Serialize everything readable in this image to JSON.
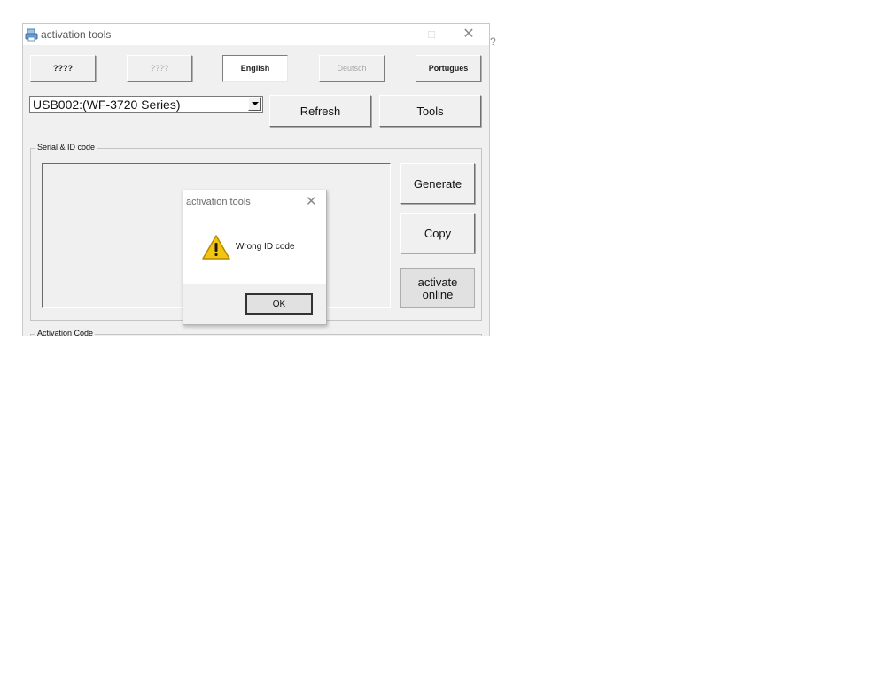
{
  "window": {
    "title": "activation tools",
    "controls": {
      "minimize": "–",
      "maximize": "□",
      "close": "✕"
    }
  },
  "language_buttons": [
    {
      "label": "????"
    },
    {
      "label": "????"
    },
    {
      "label": "English"
    },
    {
      "label": "Deutsch"
    },
    {
      "label": "Portugues"
    }
  ],
  "device_select": {
    "value": "USB002:(WF-3720 Series)"
  },
  "toolbar": {
    "refresh_label": "Refresh",
    "tools_label": "Tools"
  },
  "serial_group": {
    "label": "Serial & ID code",
    "generate_label": "Generate",
    "copy_label": "Copy",
    "activate_online_line1": "activate",
    "activate_online_line2": "online"
  },
  "activation_group": {
    "label": "Activation Code"
  },
  "dialog": {
    "title": "activation tools",
    "close_glyph": "✕",
    "message": "Wrong ID code",
    "ok_label": "OK"
  },
  "icons": {
    "app": "printer-icon",
    "warning": "warning-icon",
    "warning_color": "#f2c511"
  }
}
